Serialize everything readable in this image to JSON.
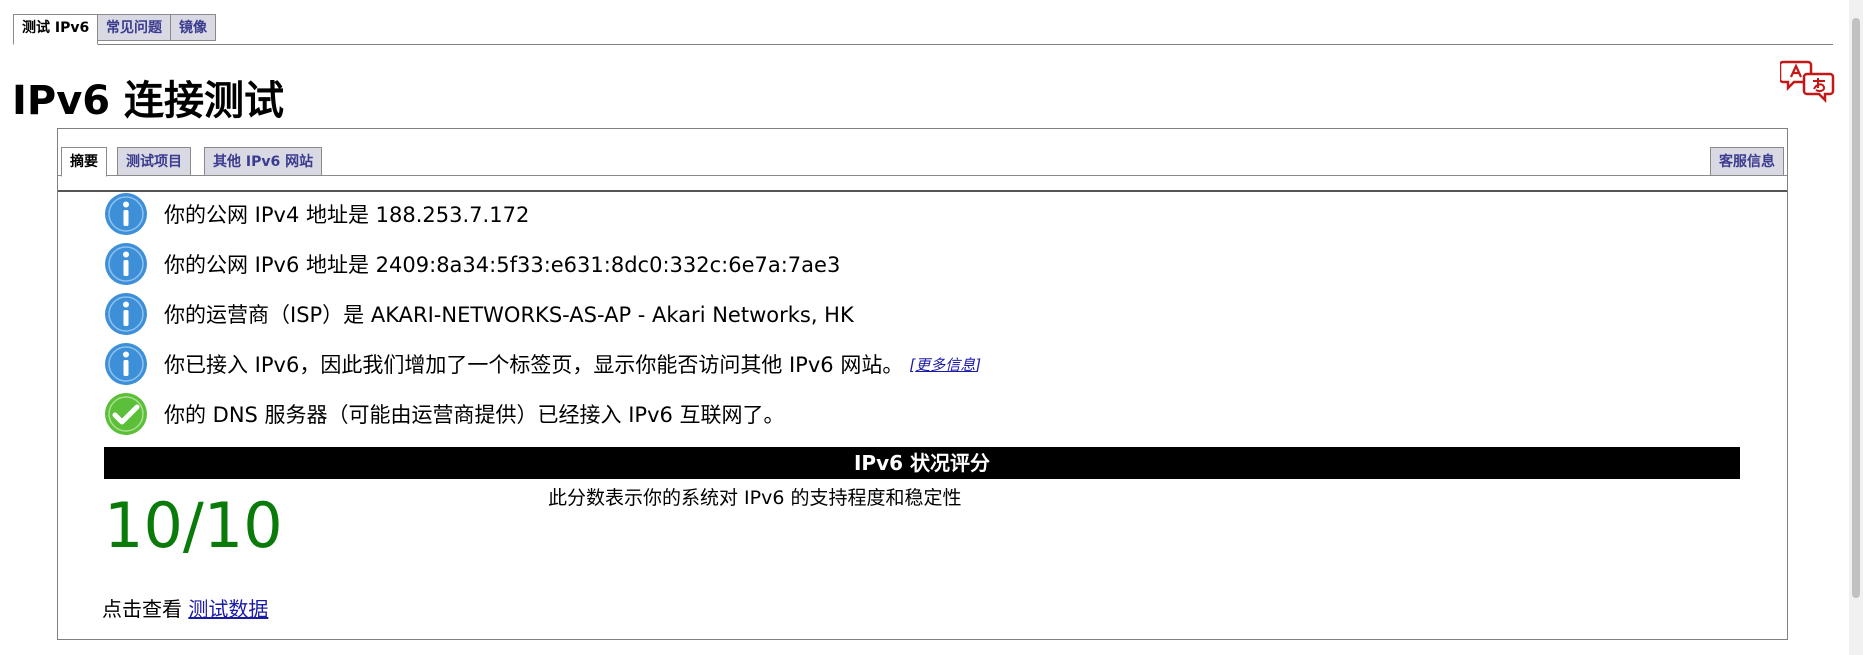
{
  "top_tabs": [
    {
      "label": "测试 IPv6",
      "active": true
    },
    {
      "label": "常见问题",
      "active": false
    },
    {
      "label": "镜像",
      "active": false
    }
  ],
  "page_title": "IPv6 连接测试",
  "inner_tabs": [
    {
      "label": "摘要",
      "active": true
    },
    {
      "label": "测试项目",
      "active": false
    },
    {
      "label": "其他 IPv6 网站",
      "active": false
    }
  ],
  "support_tab": "客服信息",
  "info_lines": [
    {
      "icon": "info-icon",
      "text": "你的公网 IPv4 地址是 188.253.7.172"
    },
    {
      "icon": "info-icon",
      "text": "你的公网 IPv6 地址是 2409:8a34:5f33:e631:8dc0:332c:6e7a:7ae3"
    },
    {
      "icon": "info-icon",
      "text": "你的运营商（ISP）是 AKARI-NETWORKS-AS-AP - Akari Networks, HK"
    },
    {
      "icon": "info-icon",
      "text": "你已接入 IPv6，因此我们增加了一个标签页，显示你能否访问其他 IPv6 网站。",
      "link": "更多信息"
    },
    {
      "icon": "check-icon",
      "text": "你的 DNS 服务器（可能由运营商提供）已经接入 IPv6 互联网了。"
    }
  ],
  "score": {
    "heading": "IPv6 状况评分",
    "value": "10/10",
    "description": "此分数表示你的系统对 IPv6 的支持程度和稳定性",
    "view_prefix": "点击查看",
    "view_link": "测试数据"
  },
  "colors": {
    "info": "#3d8fd8",
    "check": "#5cbf3a",
    "score": "#0a7a0a",
    "link": "#1a1aa6",
    "tab_bg": "#d9d9e3",
    "tab_text": "#3b3b8f"
  }
}
